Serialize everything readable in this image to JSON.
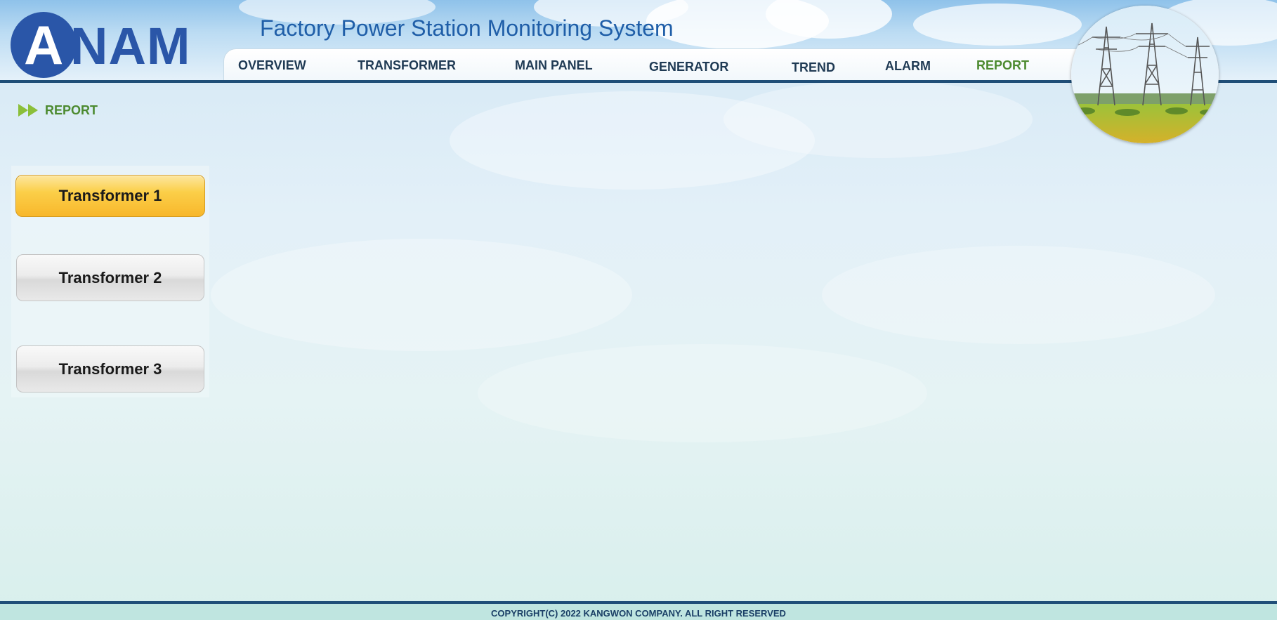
{
  "app": {
    "logo_initial": "A",
    "logo_rest": "NAM",
    "title": "Factory Power Station Monitoring System"
  },
  "nav": {
    "items": [
      {
        "label": "OVERVIEW",
        "active": false
      },
      {
        "label": "TRANSFORMER",
        "active": false
      },
      {
        "label": "MAIN PANEL",
        "active": false
      },
      {
        "label": "GENERATOR",
        "active": false
      },
      {
        "label": "TREND",
        "active": false
      },
      {
        "label": "ALARM",
        "active": false
      },
      {
        "label": "REPORT",
        "active": true
      }
    ]
  },
  "breadcrumb": {
    "label": "REPORT"
  },
  "sidebar": {
    "buttons": [
      {
        "label": "Transformer 1",
        "selected": true
      },
      {
        "label": "Transformer 2",
        "selected": false
      },
      {
        "label": "Transformer 3",
        "selected": false
      }
    ]
  },
  "footer": {
    "copyright": "COPYRIGHT(C) 2022 KANGWON COMPANY. ALL RIGHT RESERVED"
  },
  "colors": {
    "brand_blue": "#2a56a8",
    "header_line": "#1f4e78",
    "active_green": "#4c8a2f",
    "selected_button": "#f8b72b"
  }
}
